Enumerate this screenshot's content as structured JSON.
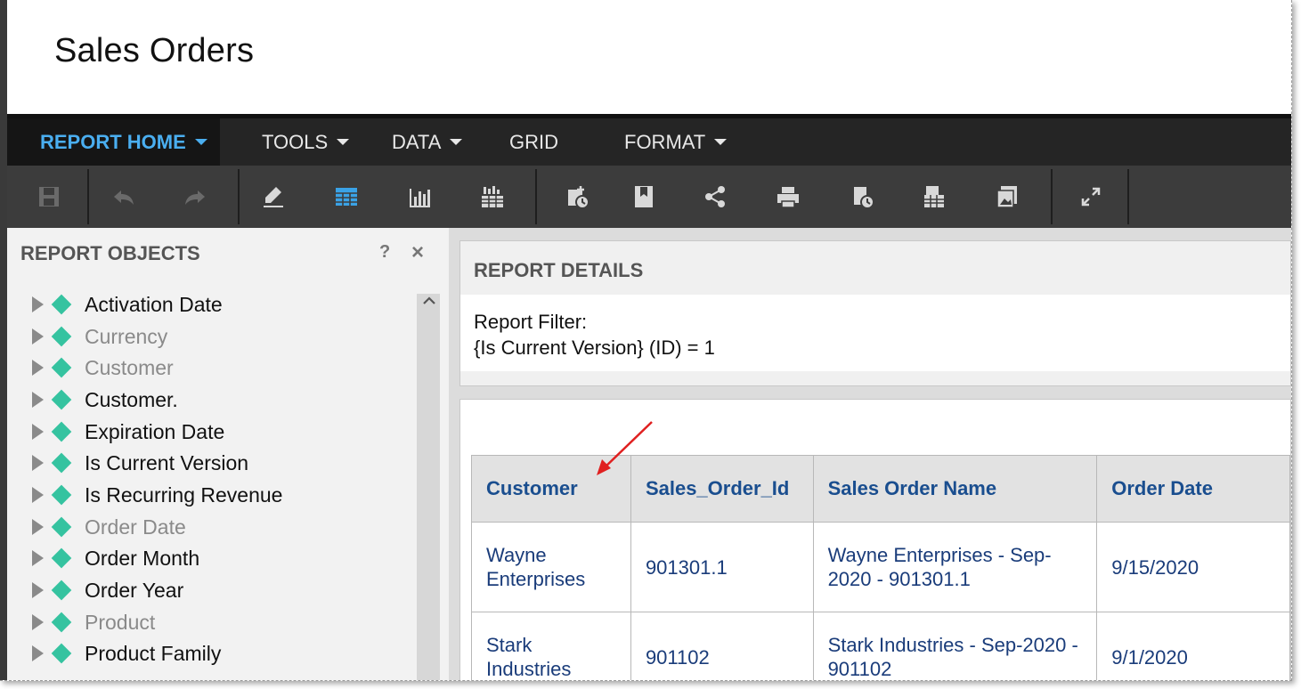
{
  "window": {
    "title": "Sales Orders"
  },
  "menu": {
    "items": [
      {
        "label": "REPORT HOME",
        "has_caret": true,
        "active": true
      },
      {
        "label": "TOOLS",
        "has_caret": true,
        "active": false
      },
      {
        "label": "DATA",
        "has_caret": true,
        "active": false
      },
      {
        "label": "GRID",
        "has_caret": false,
        "active": false
      },
      {
        "label": "FORMAT",
        "has_caret": true,
        "active": false
      }
    ]
  },
  "toolbar": {
    "buttons": [
      "save-icon",
      "undo-icon",
      "redo-icon",
      "edit-icon",
      "grid-view-icon",
      "chart-view-icon",
      "grid-and-chart-icon",
      "schedule-add-icon",
      "bookmark-icon",
      "share-icon",
      "print-icon",
      "subscribe-icon",
      "export-icon",
      "export-image-icon",
      "fullscreen-icon"
    ]
  },
  "report_objects": {
    "header": "REPORT OBJECTS",
    "help": "?",
    "close": "×",
    "items": [
      {
        "label": "Activation Date",
        "dim": false
      },
      {
        "label": "Currency",
        "dim": true
      },
      {
        "label": "Customer",
        "dim": true
      },
      {
        "label": "Customer.",
        "dim": false
      },
      {
        "label": "Expiration Date",
        "dim": false
      },
      {
        "label": "Is Current Version",
        "dim": false
      },
      {
        "label": "Is Recurring Revenue",
        "dim": false
      },
      {
        "label": "Order Date",
        "dim": true
      },
      {
        "label": "Order Month",
        "dim": false
      },
      {
        "label": "Order Year",
        "dim": false
      },
      {
        "label": "Product",
        "dim": true
      },
      {
        "label": "Product Family",
        "dim": false
      }
    ]
  },
  "report_details": {
    "title": "REPORT DETAILS",
    "filter_label": "Report Filter:",
    "filter_value": "{Is Current Version} (ID) = 1"
  },
  "grid": {
    "columns": [
      "Customer",
      "Sales_Order_Id",
      "Sales Order Name",
      "Order Date"
    ],
    "rows": [
      [
        "Wayne Enterprises",
        "901301.1",
        "Wayne Enterprises - Sep-2020 - 901301.1",
        "9/15/2020"
      ],
      [
        "Stark Industries",
        "901102",
        "Stark Industries - Sep-2020 - 901102",
        "9/1/2020"
      ]
    ]
  },
  "colors": {
    "accent": "#4aaef0",
    "menubar": "#252525",
    "toolbar": "#3c3c3c",
    "object_icon": "#35c3a0",
    "grid_text": "#1a3c7a",
    "annotation_arrow": "#e02020"
  }
}
